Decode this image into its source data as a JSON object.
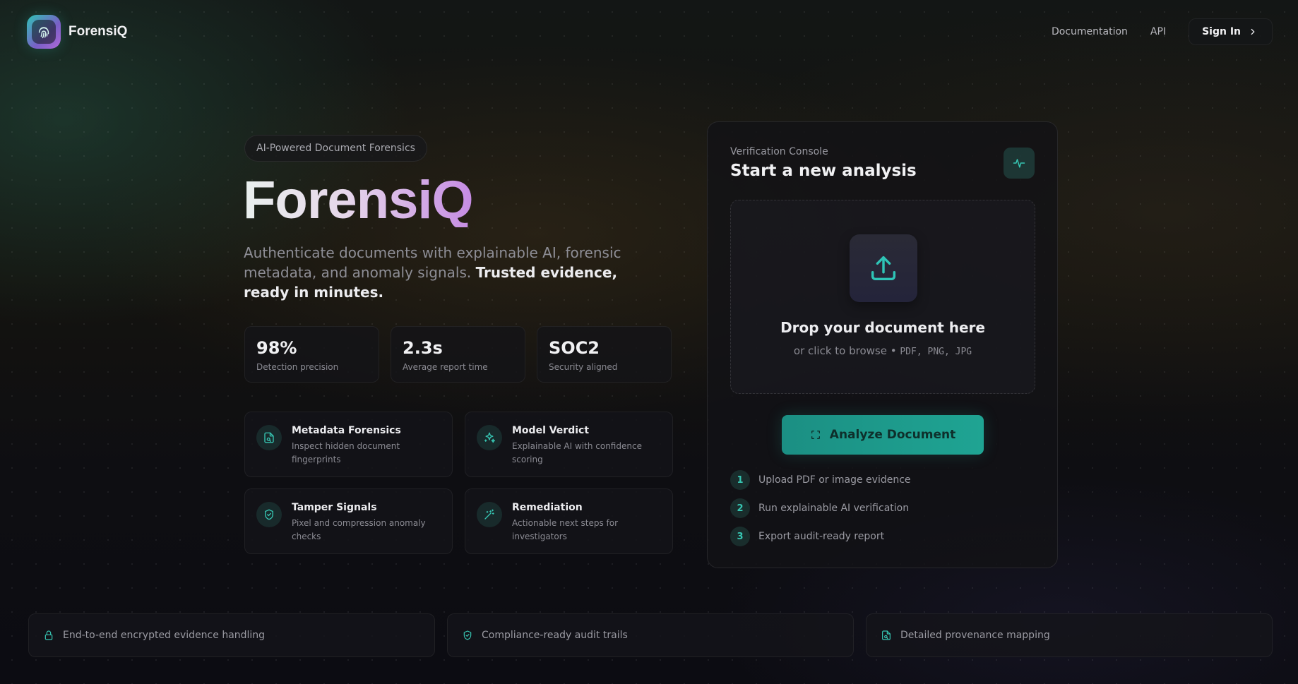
{
  "brand": {
    "name": "ForensiQ",
    "icon": "fingerprint-icon"
  },
  "nav": {
    "documentation": "Documentation",
    "api": "API",
    "sign_in": "Sign In"
  },
  "hero": {
    "badge": "AI-Powered Document Forensics",
    "title": "ForensiQ",
    "desc_plain": "Authenticate documents with explainable AI, forensic metadata, and anomaly signals.",
    "desc_strong": "Trusted evidence, ready in minutes."
  },
  "stats": [
    {
      "value": "98%",
      "label": "Detection precision"
    },
    {
      "value": "2.3s",
      "label": "Average report time"
    },
    {
      "value": "SOC2",
      "label": "Security aligned"
    }
  ],
  "features": [
    {
      "title": "Metadata Forensics",
      "desc": "Inspect hidden document fingerprints",
      "icon": "file-search-icon"
    },
    {
      "title": "Model Verdict",
      "desc": "Explainable AI with confidence scoring",
      "icon": "sparkles-icon"
    },
    {
      "title": "Tamper Signals",
      "desc": "Pixel and compression anomaly checks",
      "icon": "shield-check-icon"
    },
    {
      "title": "Remediation",
      "desc": "Actionable next steps for investigators",
      "icon": "wand-icon"
    }
  ],
  "console": {
    "kicker": "Verification Console",
    "title": "Start a new analysis",
    "drop_title": "Drop your document here",
    "drop_hint": "or click to browse •",
    "drop_formats": "PDF, PNG, JPG",
    "analyze_label": "Analyze Document",
    "steps": [
      {
        "num": "1",
        "label": "Upload PDF or image evidence"
      },
      {
        "num": "2",
        "label": "Run explainable AI verification"
      },
      {
        "num": "3",
        "label": "Export audit-ready report"
      }
    ]
  },
  "strips": [
    {
      "label": "End-to-end encrypted evidence handling",
      "icon": "lock-icon"
    },
    {
      "label": "Compliance-ready audit trails",
      "icon": "shield-check-icon"
    },
    {
      "label": "Detailed provenance mapping",
      "icon": "file-search-icon"
    }
  ],
  "colors": {
    "accent": "#2ec4b6",
    "accent_button": "#1fa493",
    "title_gradient_end": "#c58be3",
    "background": "#0c0c10"
  }
}
